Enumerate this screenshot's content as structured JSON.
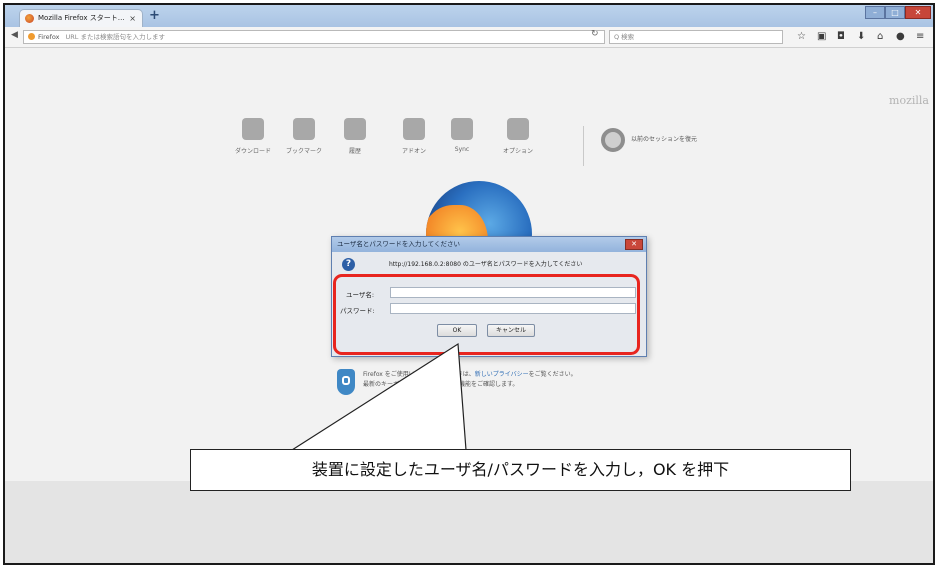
{
  "browser": {
    "tab_title": "Mozilla Firefox スタート…",
    "tab_close": "×",
    "new_tab": "+",
    "window_controls": {
      "minimize": "–",
      "maximize": "□",
      "close": "✕"
    },
    "back_icon": "back-arrow-icon",
    "url_brand": "Firefox",
    "url_placeholder": "URL または検索語句を入力します",
    "reload_icon": "↻",
    "search_placeholder": "Q 検索",
    "toolbar_icons": [
      "star-icon",
      "library-icon",
      "pocket-icon",
      "download-icon",
      "home-icon",
      "sync-icon",
      "menu-icon"
    ]
  },
  "page": {
    "brand_wordmark": "mozilla",
    "info_text_line1": "Firefox をご使用いただきましたときは、",
    "info_link": "新しいプライバシー",
    "info_text_line1_end": "をご覧ください。",
    "info_text_line2": "最新のキーボードショートカットや機能をご確認します。",
    "launcher": [
      {
        "label": "ダウンロード",
        "icon": "download-icon"
      },
      {
        "label": "ブックマーク",
        "icon": "bookmarks-icon"
      },
      {
        "label": "履歴",
        "icon": "history-icon"
      },
      {
        "label": "アドオン",
        "icon": "addons-icon"
      },
      {
        "label": "Sync",
        "icon": "sync-icon"
      },
      {
        "label": "オプション",
        "icon": "options-icon"
      }
    ],
    "restore_session": "以前のセッションを復元"
  },
  "dialog": {
    "title": "ユーザ名とパスワードを入力してください",
    "close_label": "✕",
    "question_glyph": "?",
    "message": "http://192.168.0.2:8080 のユーザ名とパスワードを入力してください",
    "username_label": "ユーザ名:",
    "password_label": "パスワード:",
    "username_value": "",
    "password_value": "",
    "ok_label": "OK",
    "cancel_label": "キャンセル"
  },
  "annotation": {
    "callout_text": "装置に設定したユーザ名/パスワードを入力し，OK を押下",
    "highlight_color": "#e8251f"
  }
}
